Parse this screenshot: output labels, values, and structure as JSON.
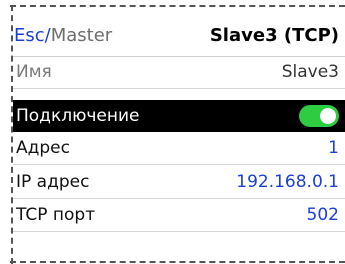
{
  "header": {
    "crumb_esc": "Esc",
    "crumb_sep": "/",
    "crumb_master": "Master",
    "title": "Slave3 (TCP)"
  },
  "rows": {
    "name": {
      "label": "Имя",
      "value": "Slave3"
    },
    "connection": {
      "label": "Подключение",
      "toggle_on": true
    },
    "address": {
      "label": "Адрес",
      "value": "1"
    },
    "ip": {
      "label": "IP адрес",
      "value": "192.168.0.1"
    },
    "port": {
      "label": "TCP порт",
      "value": "502"
    }
  },
  "colors": {
    "accent": "#1a3fd6",
    "toggle_on": "#2ecc40",
    "selected_row": "#000000"
  }
}
